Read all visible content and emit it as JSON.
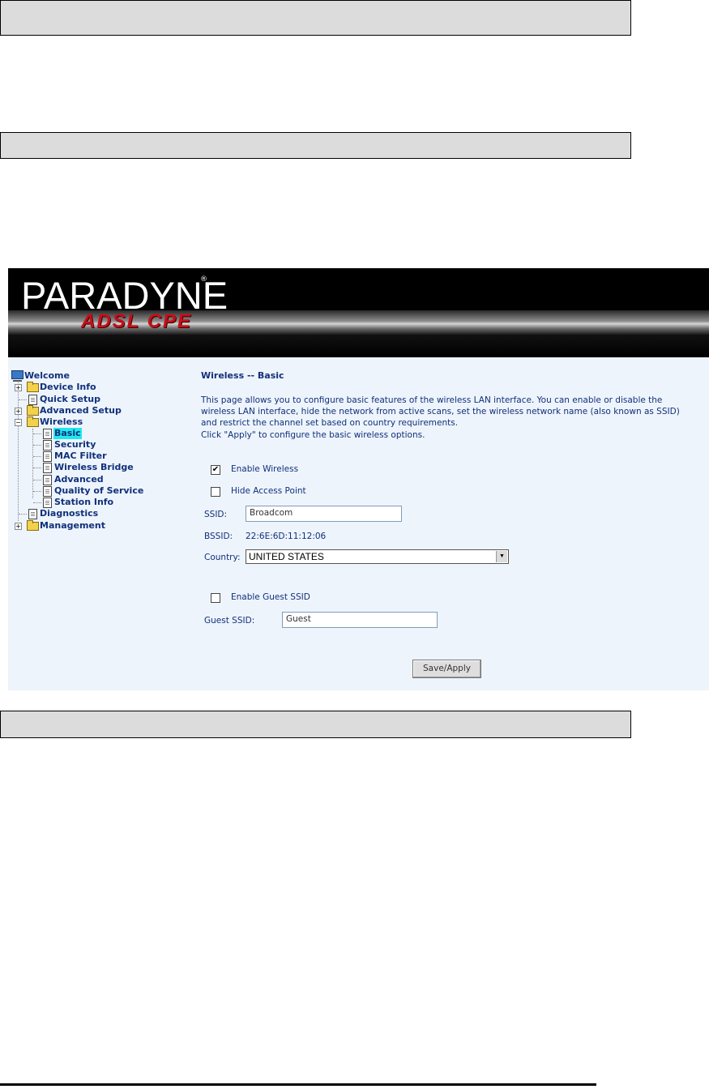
{
  "header": {
    "logo_text": "PARADYNE",
    "logo_sub": "ADSL CPE",
    "logo_reg": "®"
  },
  "sidebar": {
    "welcome": "Welcome",
    "device_info": "Device Info",
    "quick_setup": "Quick Setup",
    "advanced_setup": "Advanced Setup",
    "wireless": "Wireless",
    "wireless_items": [
      "Basic",
      "Security",
      "MAC Filter",
      "Wireless Bridge",
      "Advanced",
      "Quality of Service",
      "Station Info"
    ],
    "diagnostics": "Diagnostics",
    "management": "Management"
  },
  "main": {
    "title": "Wireless -- Basic",
    "description": "This page allows you to configure basic features of the wireless LAN interface. You can enable or disable the wireless LAN interface, hide the network from active scans, set the wireless network name (also known as SSID) and restrict the channel set based on country requirements.",
    "apply_hint": "Click \"Apply\" to configure the basic wireless options.",
    "enable_wireless_label": "Enable Wireless",
    "enable_wireless_checked": "✔",
    "hide_ap_label": "Hide Access Point",
    "ssid_label": "SSID:",
    "ssid_value": "Broadcom",
    "bssid_label": "BSSID:",
    "bssid_value": "22:6E:6D:11:12:06",
    "country_label": "Country:",
    "country_value": "UNITED STATES",
    "enable_guest_label": "Enable Guest SSID",
    "guest_ssid_label": "Guest SSID:",
    "guest_ssid_value": "Guest",
    "save_button": "Save/Apply"
  }
}
